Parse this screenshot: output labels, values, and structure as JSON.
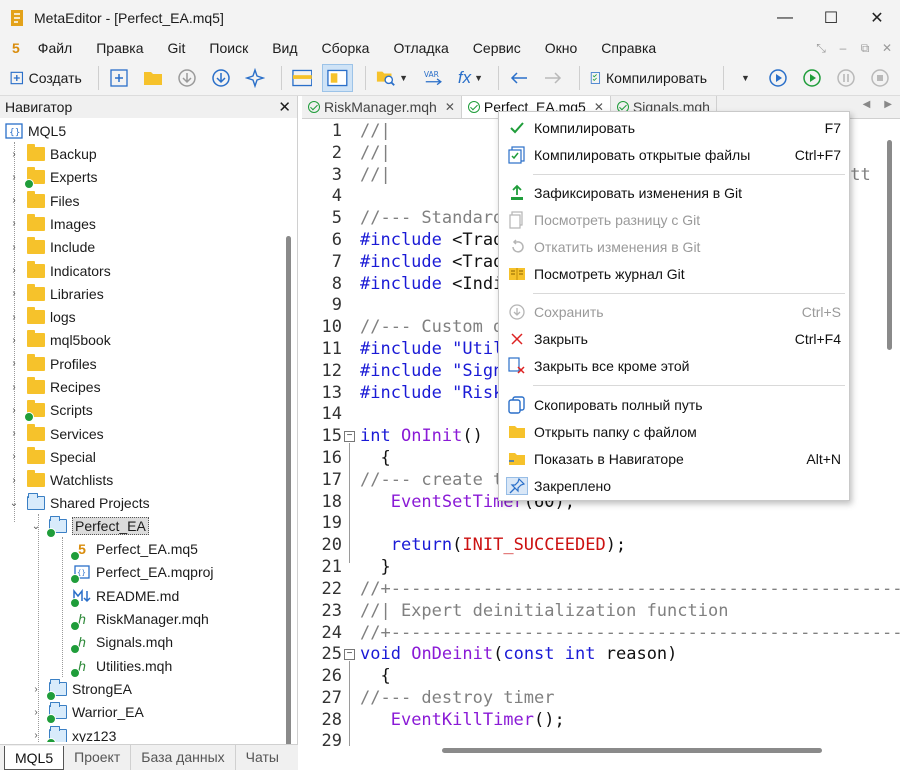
{
  "window": {
    "app_name_title": "MetaEditor - [Perfect_EA.mq5]",
    "controls": [
      "—",
      "☐",
      "✕"
    ]
  },
  "menubar": {
    "logo": "5",
    "items": [
      "Файл",
      "Правка",
      "Git",
      "Поиск",
      "Вид",
      "Сборка",
      "Отладка",
      "Сервис",
      "Окно",
      "Справка"
    ]
  },
  "toolbar": {
    "create_label": "Создать",
    "compile_label": "Компилировать",
    "var_label": "VAR",
    "fx_label": "fx"
  },
  "navigator": {
    "title": "Навигатор",
    "root": "MQL5",
    "items": [
      {
        "label": "Backup",
        "check": false
      },
      {
        "label": "Experts",
        "check": true
      },
      {
        "label": "Files",
        "check": false
      },
      {
        "label": "Images",
        "check": false
      },
      {
        "label": "Include",
        "check": false
      },
      {
        "label": "Indicators",
        "check": false
      },
      {
        "label": "Libraries",
        "check": false
      },
      {
        "label": "logs",
        "check": false
      },
      {
        "label": "mql5book",
        "check": false
      },
      {
        "label": "Profiles",
        "check": false
      },
      {
        "label": "Recipes",
        "check": false
      },
      {
        "label": "Scripts",
        "check": true
      },
      {
        "label": "Services",
        "check": false
      },
      {
        "label": "Special",
        "check": false
      },
      {
        "label": "Watchlists",
        "check": false
      }
    ],
    "shared": "Shared Projects",
    "project": "Perfect_EA",
    "files": [
      {
        "label": "Perfect_EA.mq5",
        "icon": "mq5-file-icon"
      },
      {
        "label": "Perfect_EA.mqproj",
        "icon": "project-file-icon"
      },
      {
        "label": "README.md",
        "icon": "markdown-file-icon"
      },
      {
        "label": "RiskManager.mqh",
        "icon": "header-file-icon"
      },
      {
        "label": "Signals.mqh",
        "icon": "header-file-icon"
      },
      {
        "label": "Utilities.mqh",
        "icon": "header-file-icon"
      }
    ],
    "other_projects": [
      "StrongEA",
      "Warrior_EA",
      "xyz123"
    ],
    "tabs": [
      "MQL5",
      "Проект",
      "База данных",
      "Чаты"
    ]
  },
  "editor": {
    "tabs": [
      "RiskManager.mqh",
      "Perfect_EA.mq5",
      "Signals.mqh"
    ],
    "line_numbers": [
      "1",
      "2",
      "3",
      "4",
      "5",
      "6",
      "7",
      "8",
      "9",
      "10",
      "11",
      "12",
      "13",
      "14",
      "15",
      "16",
      "17",
      "18",
      "19",
      "20",
      "21",
      "22",
      "23",
      "24",
      "25",
      "26",
      "27",
      "28",
      "29"
    ],
    "code": {
      "l1": "//|",
      "l2": "//|",
      "l3": "//|",
      "l3_tail": "ntt",
      "l5": "//--- Standard",
      "l6_inc": "#include",
      "l6_rest": " <Trad",
      "l7_inc": "#include",
      "l7_rest": " <Trad",
      "l8_inc": "#include",
      "l8_rest": " <Indi",
      "l10": "//--- Custom d",
      "l11_inc": "#include",
      "l11_rest": " \"Util",
      "l12_inc": "#include",
      "l12_rest": " \"Sign",
      "l13_inc": "#include",
      "l13_rest": " \"Risk",
      "l15_type": "int",
      "l15_fn": "OnInit",
      "l15_rest": "()",
      "l16": "  {",
      "l17": "//--- create t",
      "l18_fn": "EventSetTimer",
      "l18_rest": "(60);",
      "l20_kw": "return",
      "l20_const": "INIT_SUCCEEDED",
      "l21": "  }",
      "l22": "//+-----------------------------------------------------------------",
      "l23": "//| Expert deinitialization function",
      "l24": "//+-----------------------------------------------------------------",
      "l25_type": "void",
      "l25_fn": "OnDeinit",
      "l25_const": "const",
      "l25_int": "int",
      "l25_reason": "reason",
      "l26": "  {",
      "l27": "//--- destroy timer",
      "l28_fn": "EventKillTimer",
      "l28_rest": "();"
    }
  },
  "context_menu": {
    "items": [
      {
        "label": "Компилировать",
        "shortcut": "F7",
        "enabled": true,
        "icon": "compile-check-icon"
      },
      {
        "label": "Компилировать открытые файлы",
        "shortcut": "Ctrl+F7",
        "enabled": true,
        "icon": "compile-all-icon"
      },
      {
        "label": "Зафиксировать изменения в Git",
        "shortcut": "",
        "enabled": true,
        "icon": "git-commit-icon"
      },
      {
        "label": "Посмотреть разницу с Git",
        "shortcut": "",
        "enabled": false,
        "icon": "git-diff-icon"
      },
      {
        "label": "Откатить изменения в Git",
        "shortcut": "",
        "enabled": false,
        "icon": "git-revert-icon"
      },
      {
        "label": "Посмотреть журнал Git",
        "shortcut": "",
        "enabled": true,
        "icon": "git-log-icon"
      },
      {
        "label": "Сохранить",
        "shortcut": "Ctrl+S",
        "enabled": false,
        "icon": "save-icon"
      },
      {
        "label": "Закрыть",
        "shortcut": "Ctrl+F4",
        "enabled": true,
        "icon": "close-icon"
      },
      {
        "label": "Закрыть все кроме этой",
        "shortcut": "",
        "enabled": true,
        "icon": "close-others-icon"
      },
      {
        "label": "Скопировать полный путь",
        "shortcut": "",
        "enabled": true,
        "icon": "copy-path-icon"
      },
      {
        "label": "Открыть папку с файлом",
        "shortcut": "",
        "enabled": true,
        "icon": "open-folder-icon"
      },
      {
        "label": "Показать в Навигаторе",
        "shortcut": "Alt+N",
        "enabled": true,
        "icon": "show-in-navigator-icon"
      },
      {
        "label": "Закреплено",
        "shortcut": "",
        "enabled": true,
        "icon": "pin-icon"
      }
    ]
  },
  "colors": {
    "accent": "#1f9d3a",
    "folder": "#f6c22b",
    "keyword": "#1a1ad6",
    "function": "#8a1ad6",
    "constant": "#cc1111",
    "comment": "#808080"
  }
}
